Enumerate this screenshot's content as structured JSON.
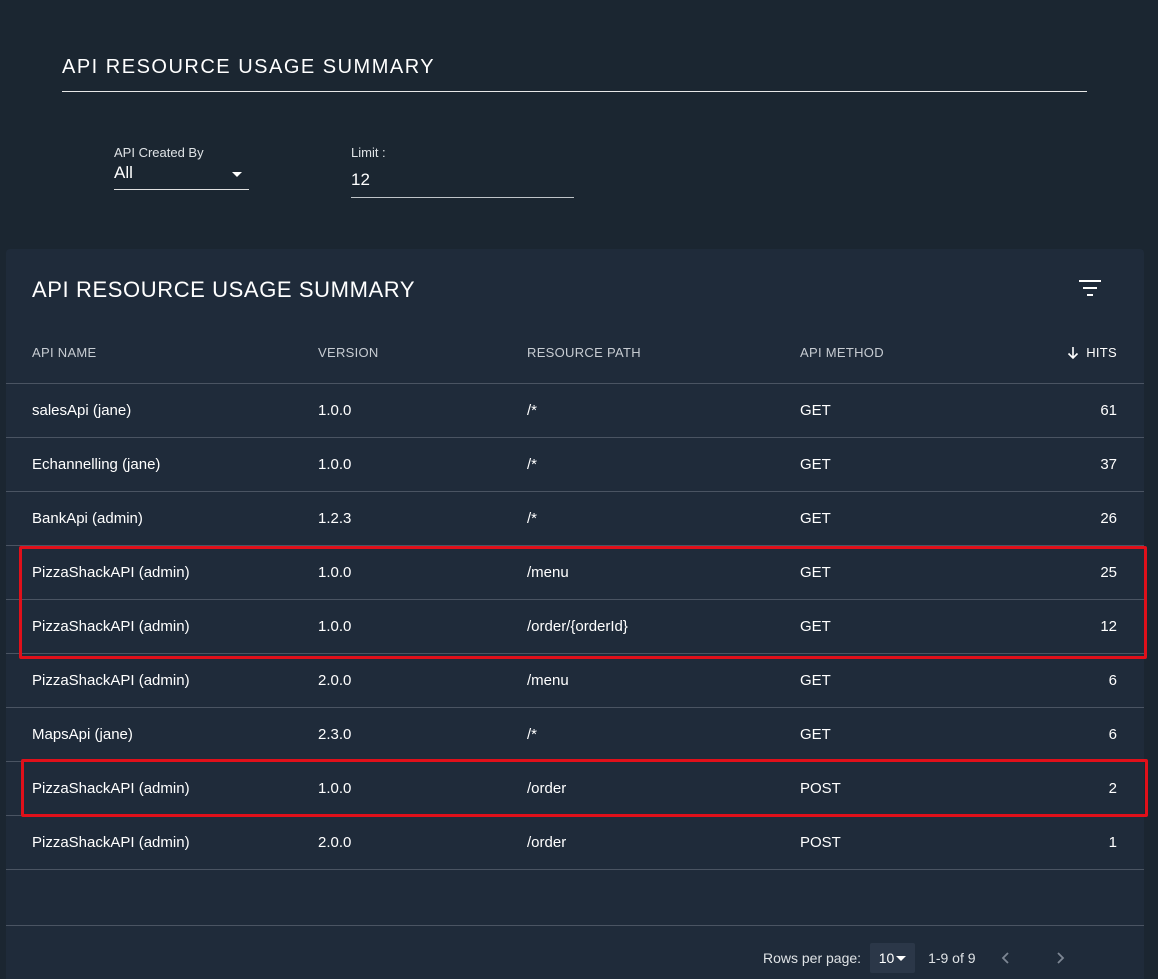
{
  "page": {
    "title": "API RESOURCE USAGE SUMMARY"
  },
  "filters": {
    "created_by": {
      "label": "API Created By",
      "value": "All"
    },
    "limit": {
      "label": "Limit :",
      "value": "12"
    }
  },
  "table": {
    "title": "API RESOURCE USAGE SUMMARY",
    "columns": [
      "API NAME",
      "VERSION",
      "RESOURCE PATH",
      "API METHOD",
      "HITS"
    ],
    "sorted_column": "HITS",
    "sort_direction": "descending",
    "rows": [
      [
        "salesApi (jane)",
        "1.0.0",
        "/*",
        "GET",
        "61"
      ],
      [
        "Echannelling (jane)",
        "1.0.0",
        "/*",
        "GET",
        "37"
      ],
      [
        "BankApi (admin)",
        "1.2.3",
        "/*",
        "GET",
        "26"
      ],
      [
        "PizzaShackAPI (admin)",
        "1.0.0",
        "/menu",
        "GET",
        "25"
      ],
      [
        "PizzaShackAPI (admin)",
        "1.0.0",
        "/order/{orderId}",
        "GET",
        "12"
      ],
      [
        "PizzaShackAPI (admin)",
        "2.0.0",
        "/menu",
        "GET",
        "6"
      ],
      [
        "MapsApi (jane)",
        "2.3.0",
        "/*",
        "GET",
        "6"
      ],
      [
        "PizzaShackAPI (admin)",
        "1.0.0",
        "/order",
        "POST",
        "2"
      ],
      [
        "PizzaShackAPI (admin)",
        "2.0.0",
        "/order",
        "POST",
        "1"
      ]
    ],
    "highlighted_row_groups": [
      [
        3,
        4
      ],
      [
        7
      ]
    ]
  },
  "pagination": {
    "rows_per_page_label": "Rows per page:",
    "rows_per_page_value": "10",
    "range_text": "1-9 of 9"
  },
  "colors": {
    "background": "#1b2631",
    "card": "#1f2b3a",
    "highlight": "#e0101a",
    "divider": "#4a5462"
  },
  "icons": [
    "dropdown-arrow-icon",
    "filter-list-icon",
    "arrow-down-icon",
    "chevron-left-icon",
    "chevron-right-icon"
  ]
}
